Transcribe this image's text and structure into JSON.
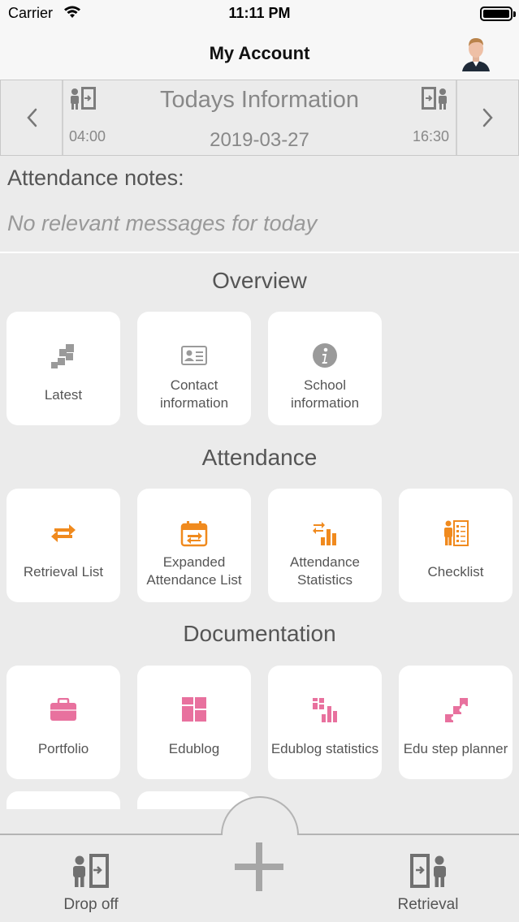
{
  "status_bar": {
    "carrier": "Carrier",
    "time": "11:11 PM"
  },
  "nav": {
    "title": "My Account"
  },
  "today": {
    "title": "Todays Information",
    "date": "2019-03-27",
    "dropoff_time": "04:00",
    "retrieval_time": "16:30"
  },
  "notes": {
    "title": "Attendance notes:",
    "message": "No relevant messages for today"
  },
  "overview": {
    "title": "Overview",
    "items": [
      {
        "label": "Latest",
        "icon": "latest-icon"
      },
      {
        "label": "Contact information",
        "icon": "contact-card-icon"
      },
      {
        "label": "School information",
        "icon": "info-icon"
      }
    ]
  },
  "attendance": {
    "title": "Attendance",
    "items": [
      {
        "label": "Retrieval List",
        "icon": "swap-arrows-icon"
      },
      {
        "label": "Expanded Attendance List",
        "icon": "calendar-swap-icon"
      },
      {
        "label": "Attendance Statistics",
        "icon": "bar-chart-swap-icon"
      },
      {
        "label": "Checklist",
        "icon": "checklist-person-icon"
      }
    ]
  },
  "documentation": {
    "title": "Documentation",
    "items": [
      {
        "label": "Portfolio",
        "icon": "briefcase-icon"
      },
      {
        "label": "Edublog",
        "icon": "grid-blocks-icon"
      },
      {
        "label": "Edublog statistics",
        "icon": "blocks-chart-icon"
      },
      {
        "label": "Edu step planner",
        "icon": "puzzle-steps-icon"
      }
    ]
  },
  "bottom_bar": {
    "dropoff_label": "Drop off",
    "retrieval_label": "Retrieval",
    "plus_icon": "plus-icon"
  },
  "colors": {
    "accent_orange": "#f08a1e",
    "accent_pink": "#e8719e",
    "icon_gray": "#8f8f8f",
    "background": "#ebebeb",
    "tile": "#ffffff"
  }
}
